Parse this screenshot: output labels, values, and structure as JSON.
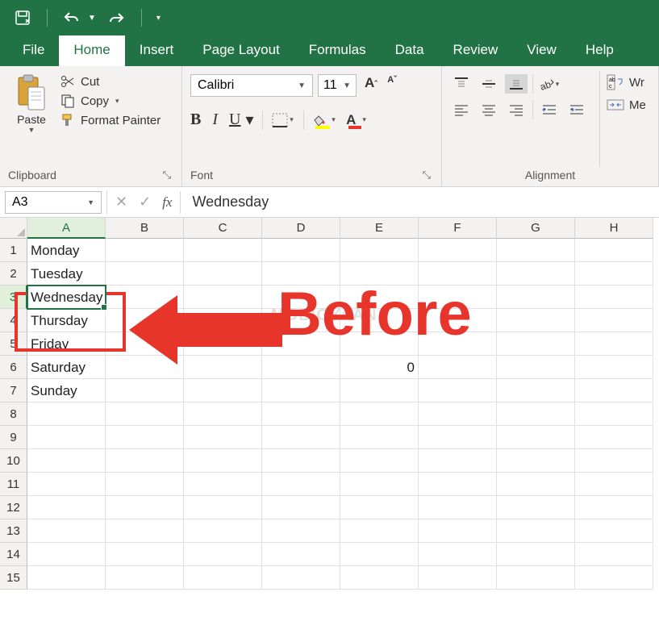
{
  "qat": {
    "save_title": "Save",
    "undo_title": "Undo",
    "redo_title": "Redo"
  },
  "tabs": {
    "file": "File",
    "home": "Home",
    "insert": "Insert",
    "page_layout": "Page Layout",
    "formulas": "Formulas",
    "data": "Data",
    "review": "Review",
    "view": "View",
    "help": "Help"
  },
  "clipboard": {
    "paste": "Paste",
    "cut": "Cut",
    "copy": "Copy",
    "format_painter": "Format Painter",
    "group_label": "Clipboard"
  },
  "font": {
    "name": "Calibri",
    "size": "11",
    "bold": "B",
    "italic": "I",
    "underline": "U",
    "font_color_letter": "A",
    "group_label": "Font"
  },
  "alignment": {
    "wrap": "Wr",
    "merge": "Me",
    "group_label": "Alignment"
  },
  "name_box": "A3",
  "fx_label": "fx",
  "formula": "Wednesday",
  "columns": [
    "A",
    "B",
    "C",
    "D",
    "E",
    "F",
    "G",
    "H"
  ],
  "row_numbers": [
    "1",
    "2",
    "3",
    "4",
    "5",
    "6",
    "7",
    "8",
    "9",
    "10",
    "11",
    "12",
    "13",
    "14",
    "15"
  ],
  "cells": {
    "A1": "Monday",
    "A2": "Tuesday",
    "A3": "Wednesday",
    "A4": "Thursday",
    "A5": "Friday",
    "A6": "Saturday",
    "A7": "Sunday",
    "E6": "0"
  },
  "active_cell": "A3",
  "annotation": {
    "label": "Before"
  },
  "watermark": {
    "prefix": "M",
    "rest": "OBIGYAAN"
  },
  "colors": {
    "brand": "#217346",
    "accent_red": "#e7352c",
    "fill": "#ffff00"
  }
}
